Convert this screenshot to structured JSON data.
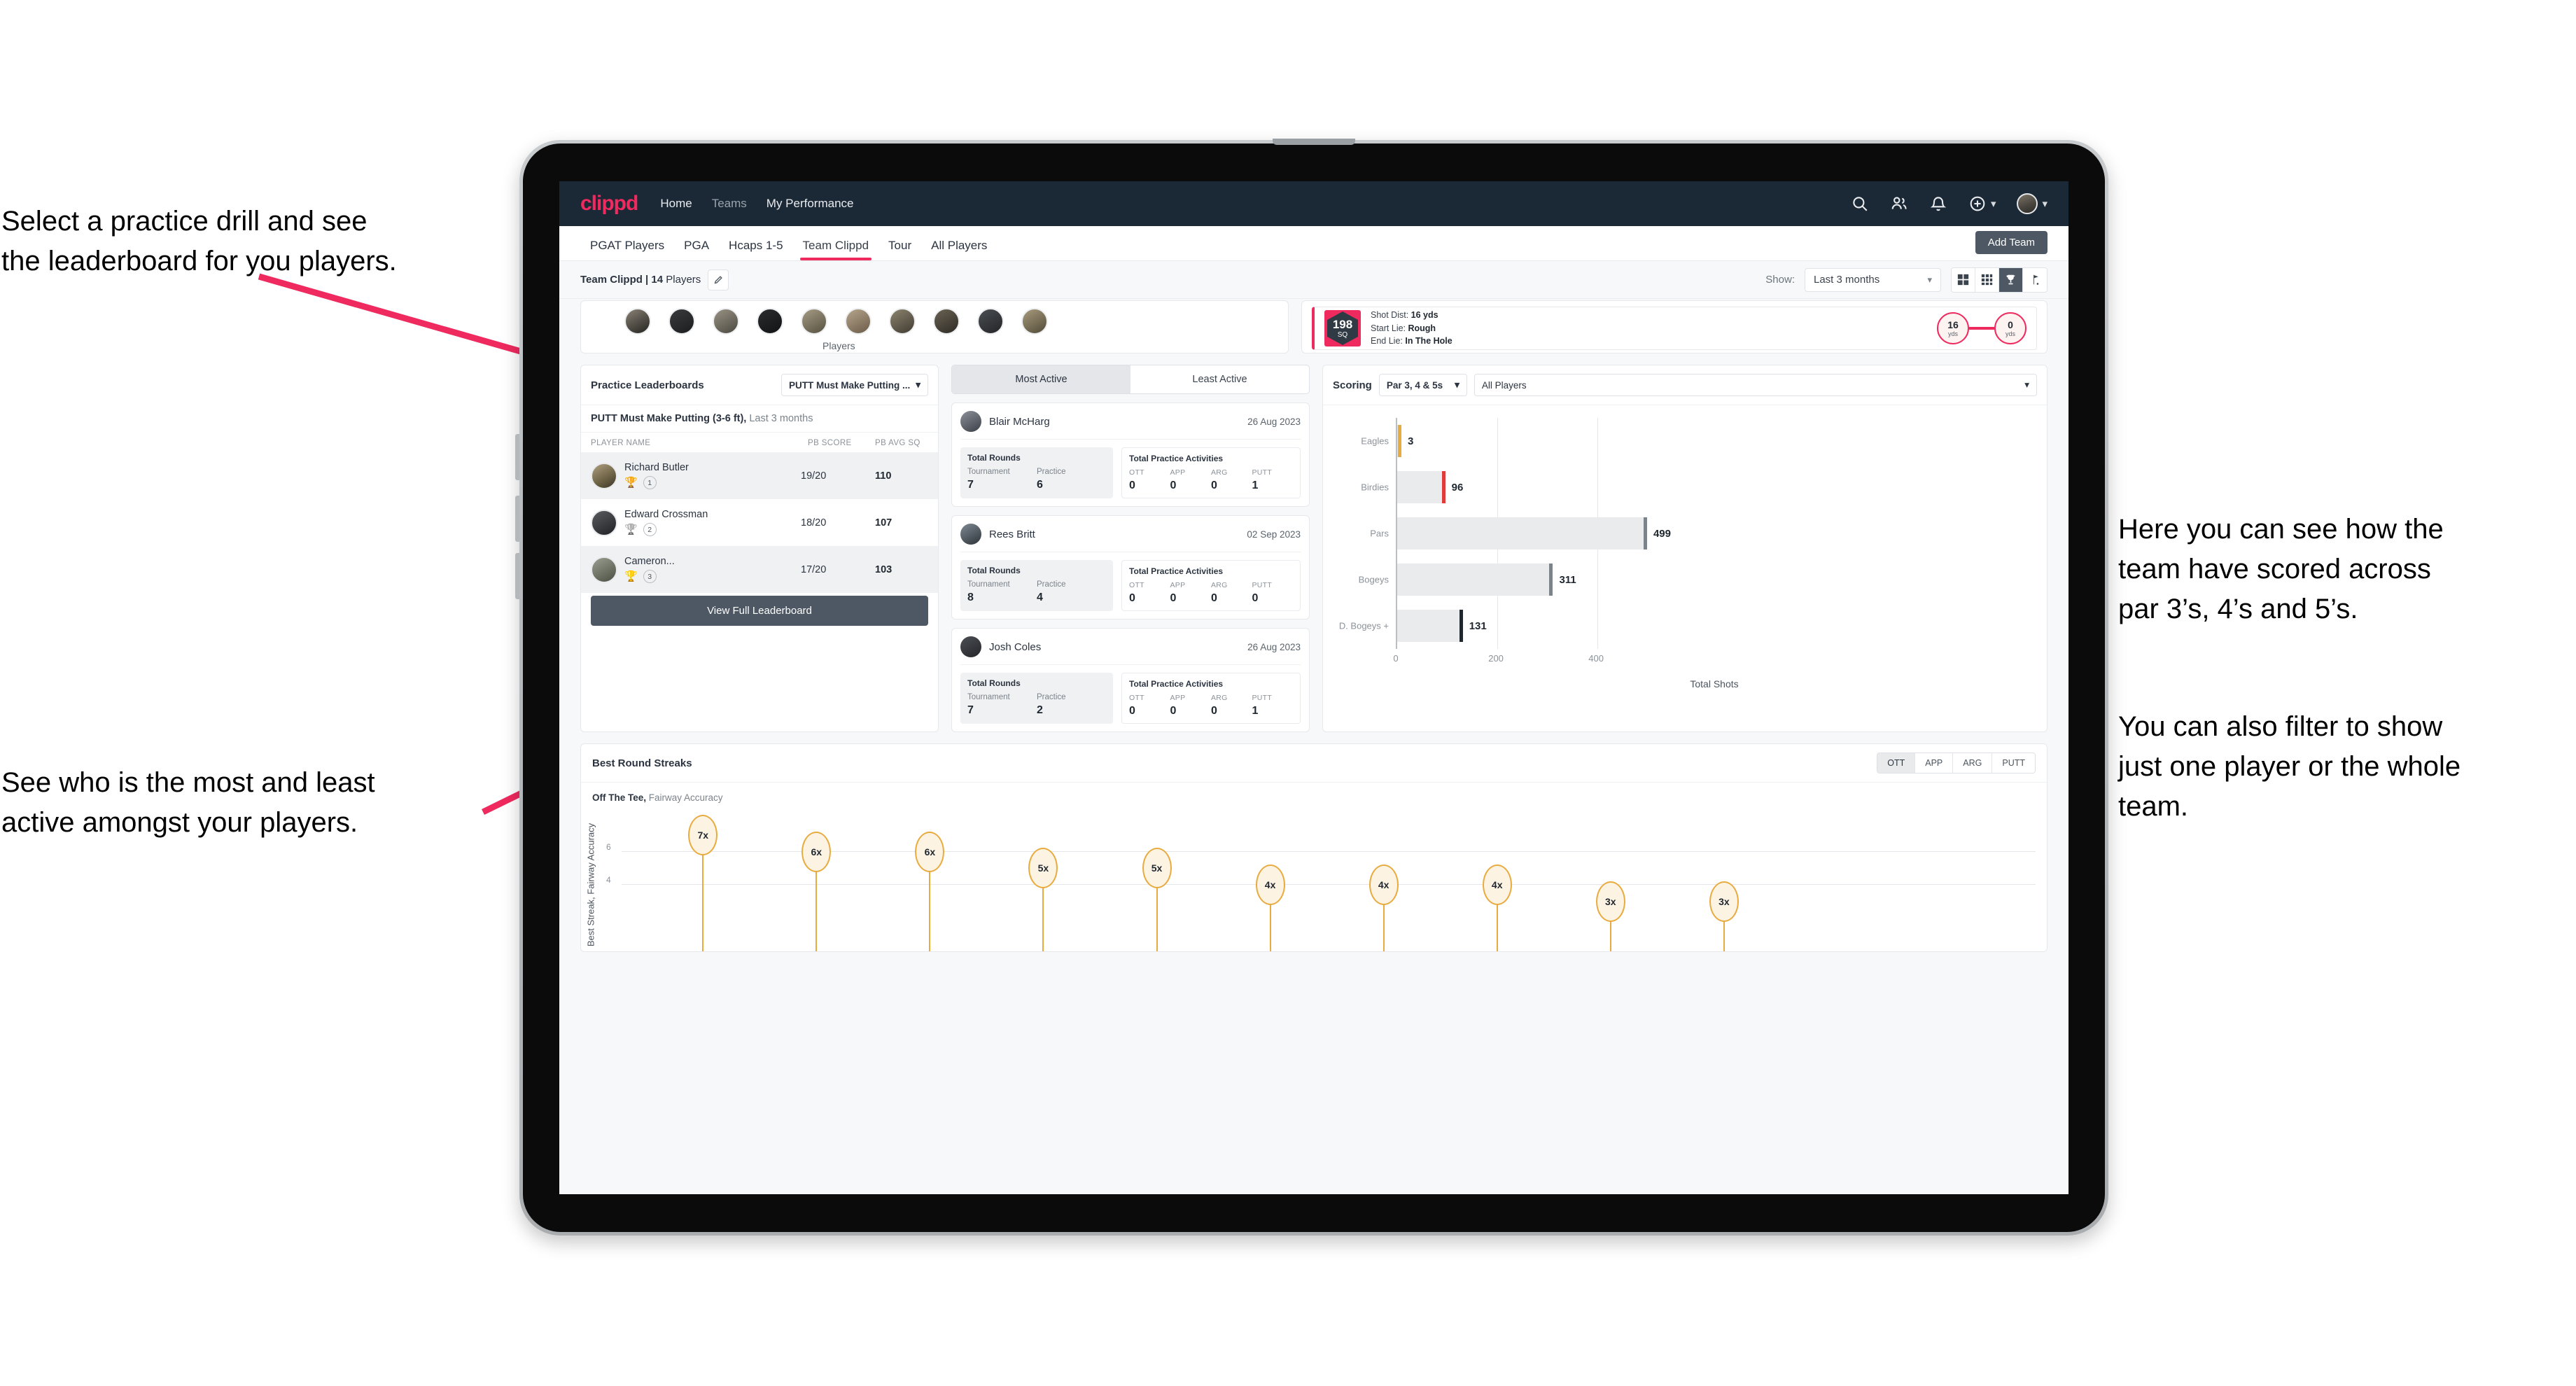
{
  "annotations": {
    "left_top": "Select a practice drill and see\nthe leaderboard for you players.",
    "left_bottom": "See who is the most and least\nactive amongst your players.",
    "right_top": "Here you can see how the\nteam have scored across\npar 3’s, 4’s and 5’s.",
    "right_bottom": "You can also filter to show\njust one player or the whole\nteam.",
    "arrow_color": "#ee2a5e"
  },
  "navbar": {
    "logo": "clippd",
    "links": [
      {
        "label": "Home",
        "active": true
      },
      {
        "label": "Teams",
        "active": false
      },
      {
        "label": "My Performance",
        "active": false
      }
    ],
    "icons": [
      "search-icon",
      "people-icon",
      "bell-icon",
      "plus-circle-icon",
      "avatar"
    ]
  },
  "tabs": {
    "items": [
      {
        "label": "PGAT Players"
      },
      {
        "label": "PGA"
      },
      {
        "label": "Hcaps 1-5"
      },
      {
        "label": "Team Clippd"
      },
      {
        "label": "Tour"
      },
      {
        "label": "All Players"
      }
    ],
    "active_index": 3,
    "add_team_label": "Add Team"
  },
  "filterbar": {
    "team_name": "Team Clippd | 14 ",
    "team_players_word": "Players",
    "edit_icon": "pencil-icon",
    "show_label": "Show:",
    "range_value": "Last 3 months",
    "view_buttons": [
      "grid-large-icon",
      "grid-small-icon",
      "trophy-icon",
      "golf-flag-icon"
    ],
    "view_active_index": 2
  },
  "top_row": {
    "players_caption": "Players",
    "shot_card": {
      "sq_value": "198",
      "sq_label": "SQ",
      "shot_dist_label": "Shot Dist: ",
      "shot_dist_value": "16 yds",
      "start_lie_label": "Start Lie: ",
      "start_lie_value": "Rough",
      "end_lie_label": "End Lie: ",
      "end_lie_value": "In The Hole",
      "node_start_value": "16",
      "node_start_unit": "yds",
      "node_end_value": "0",
      "node_end_unit": "yds"
    }
  },
  "leaderboard": {
    "title": "Practice Leaderboards",
    "drill_select": "PUTT Must Make Putting ...",
    "drill_name": "PUTT Must Make Putting (3-6 ft),",
    "drill_period": " Last 3 months",
    "columns": [
      "PLAYER NAME",
      "PB SCORE",
      "PB AVG SQ"
    ],
    "rows": [
      {
        "name": "Richard Butler",
        "rank": "1",
        "trophy": "🏆",
        "pb_score": "19/20",
        "pb_avg_sq": "110"
      },
      {
        "name": "Edward Crossman",
        "rank": "2",
        "trophy": "🏆",
        "pb_score": "18/20",
        "pb_avg_sq": "107"
      },
      {
        "name": "Cameron...",
        "rank": "3",
        "trophy": "🏆",
        "pb_score": "17/20",
        "pb_avg_sq": "103"
      }
    ],
    "view_full_label": "View Full Leaderboard"
  },
  "activity": {
    "tabs": [
      {
        "label": "Most Active",
        "active": true
      },
      {
        "label": "Least Active",
        "active": false
      }
    ],
    "total_rounds_title": "Total Rounds",
    "practice_title": "Total Practice Activities",
    "round_keys": [
      "Tournament",
      "Practice"
    ],
    "practice_keys": [
      "OTT",
      "APP",
      "ARG",
      "PUTT"
    ],
    "cards": [
      {
        "name": "Blair McHarg",
        "date": "26 Aug 2023",
        "rounds": [
          "7",
          "6"
        ],
        "practice": [
          "0",
          "0",
          "0",
          "1"
        ]
      },
      {
        "name": "Rees Britt",
        "date": "02 Sep 2023",
        "rounds": [
          "8",
          "4"
        ],
        "practice": [
          "0",
          "0",
          "0",
          "0"
        ]
      },
      {
        "name": "Josh Coles",
        "date": "26 Aug 2023",
        "rounds": [
          "7",
          "2"
        ],
        "practice": [
          "0",
          "0",
          "0",
          "1"
        ]
      }
    ]
  },
  "scoring": {
    "title": "Scoring",
    "par_filter": "Par 3, 4 & 5s",
    "player_filter": "All Players"
  },
  "streaks": {
    "title": "Best Round Streaks",
    "tabs": [
      {
        "label": "OTT",
        "active": true
      },
      {
        "label": "APP",
        "active": false
      },
      {
        "label": "ARG",
        "active": false
      },
      {
        "label": "PUTT",
        "active": false
      }
    ],
    "metric_bold": "Off The Tee,",
    "metric_rest": " Fairway Accuracy"
  },
  "chart_data": [
    {
      "type": "bar",
      "orientation": "horizontal",
      "title": "Scoring",
      "categories": [
        "Eagles",
        "Birdies",
        "Pars",
        "Bogeys",
        "D. Bogeys +"
      ],
      "values": [
        3,
        96,
        499,
        311,
        131
      ],
      "cap_colors": [
        "#e8ab3f",
        "#e03b3b",
        "#7b838b",
        "#7b838b",
        "#1f2730"
      ],
      "xlabel": "Total Shots",
      "ylabel": "",
      "xlim": [
        0,
        520
      ],
      "xticks": [
        0,
        200,
        400
      ],
      "grid": true,
      "legend": "none"
    },
    {
      "type": "scatter",
      "subtype": "lollipop",
      "title": "Best Round Streaks",
      "ylabel": "Best Streak, Fairway Accuracy",
      "xlabel": "",
      "ylim": [
        0,
        8
      ],
      "yticks": [
        4,
        6
      ],
      "values": [
        7,
        6,
        6,
        5,
        5,
        4,
        4,
        4,
        3,
        3
      ],
      "labels": [
        "7x",
        "6x",
        "6x",
        "5x",
        "5x",
        "4x",
        "4x",
        "4x",
        "3x",
        "3x"
      ],
      "marker_color": "#e8ab3f",
      "marker_fill": "#fdf3e3",
      "grid": true
    }
  ]
}
